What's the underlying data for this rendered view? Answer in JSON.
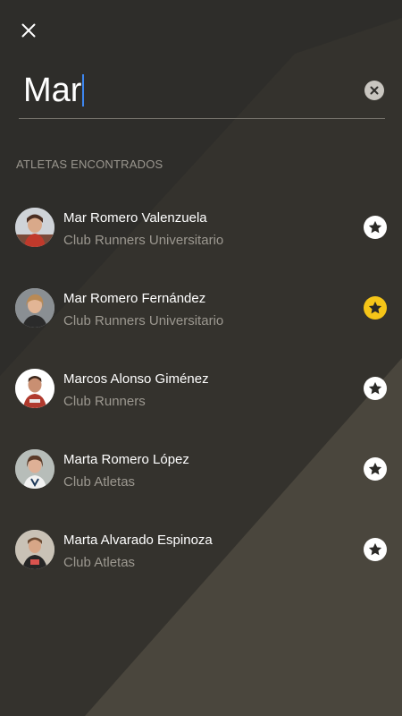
{
  "search": {
    "query": "Mar"
  },
  "results": {
    "section_title": "ATLETAS ENCONTRADOS",
    "athletes": [
      {
        "name": "Mar Romero Valenzuela",
        "club": "Club Runners Universitario",
        "favorite": false
      },
      {
        "name": "Mar Romero Fernández",
        "club": "Club Runners Universitario",
        "favorite": true
      },
      {
        "name": "Marcos Alonso Giménez",
        "club": "Club Runners",
        "favorite": false
      },
      {
        "name": "Marta Romero López",
        "club": "Club Atletas",
        "favorite": false
      },
      {
        "name": "Marta Alvarado Espinoza",
        "club": "Club Atletas",
        "favorite": false
      }
    ]
  },
  "colors": {
    "background": "#2e2d2a",
    "accent_favorite": "#f5c518",
    "caret": "#3d86ef"
  },
  "icons": {
    "close": "close-icon",
    "clear": "clear-circle-icon",
    "favorite": "star-icon"
  }
}
